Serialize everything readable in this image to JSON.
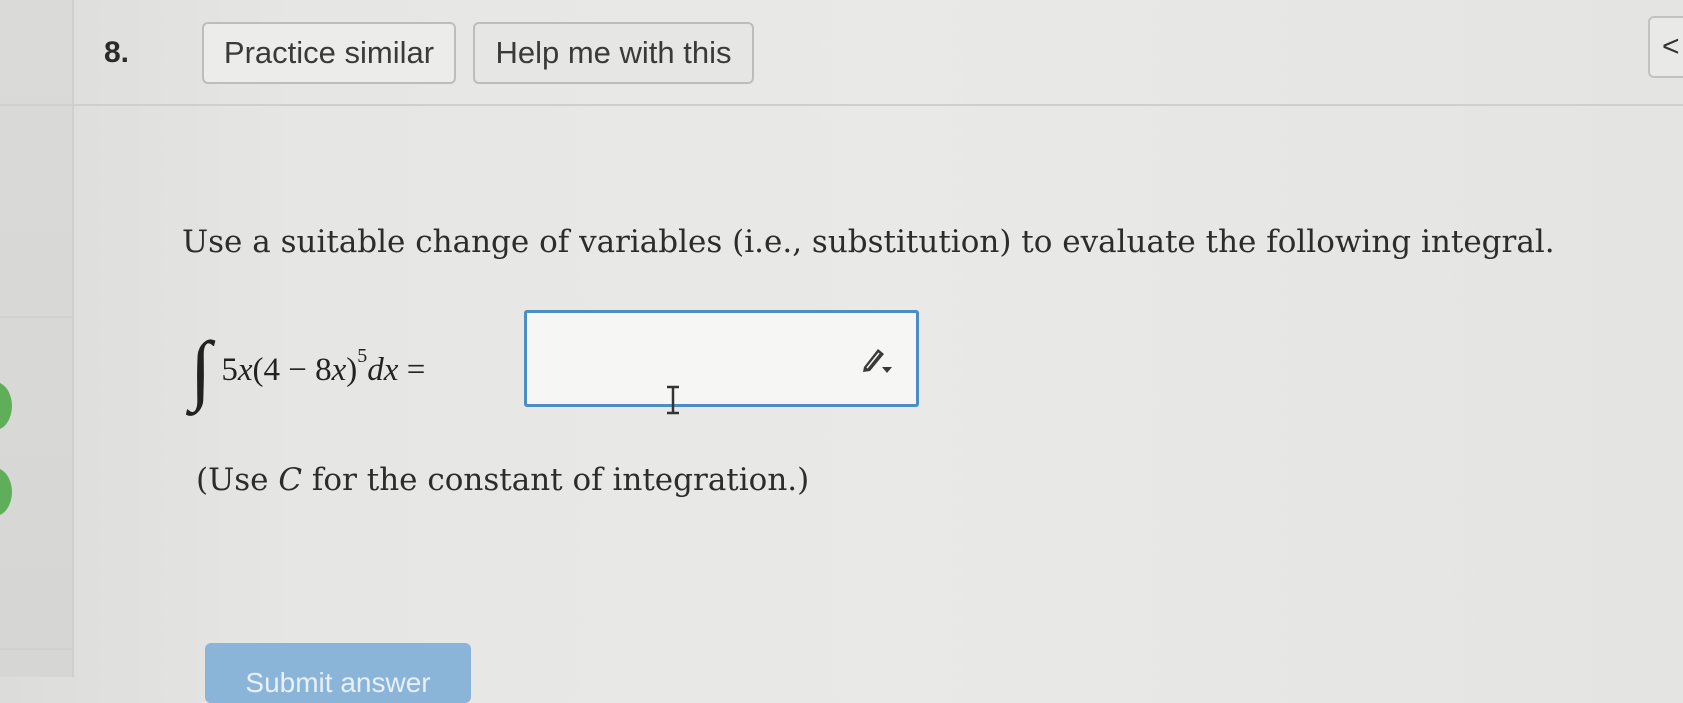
{
  "question": {
    "number": "8.",
    "practice_label": "Practice similar",
    "help_label": "Help me with this",
    "collapse_glyph": "<"
  },
  "problem": {
    "instruction": "Use a suitable change of variables (i.e., substitution) to evaluate the following integral.",
    "integral_symbol": "∫",
    "expression": {
      "coef": "5",
      "var": "x",
      "open": "(4 − 8",
      "var2": "x",
      "close": ")",
      "exponent": "5",
      "dx": "dx",
      "equals": " ="
    },
    "hint_pre": "(Use ",
    "hint_var": "C",
    "hint_post": " for the constant of integration.)"
  },
  "answer": {
    "value": ""
  },
  "submit": {
    "label": "Submit answer"
  },
  "colors": {
    "answer_border": "#4b8ec5",
    "submit_bg": "#8bb4d9",
    "status_green": "#5fae59"
  },
  "icons": [
    "pencil-icon",
    "text-cursor-icon",
    "chevron-left-icon"
  ]
}
